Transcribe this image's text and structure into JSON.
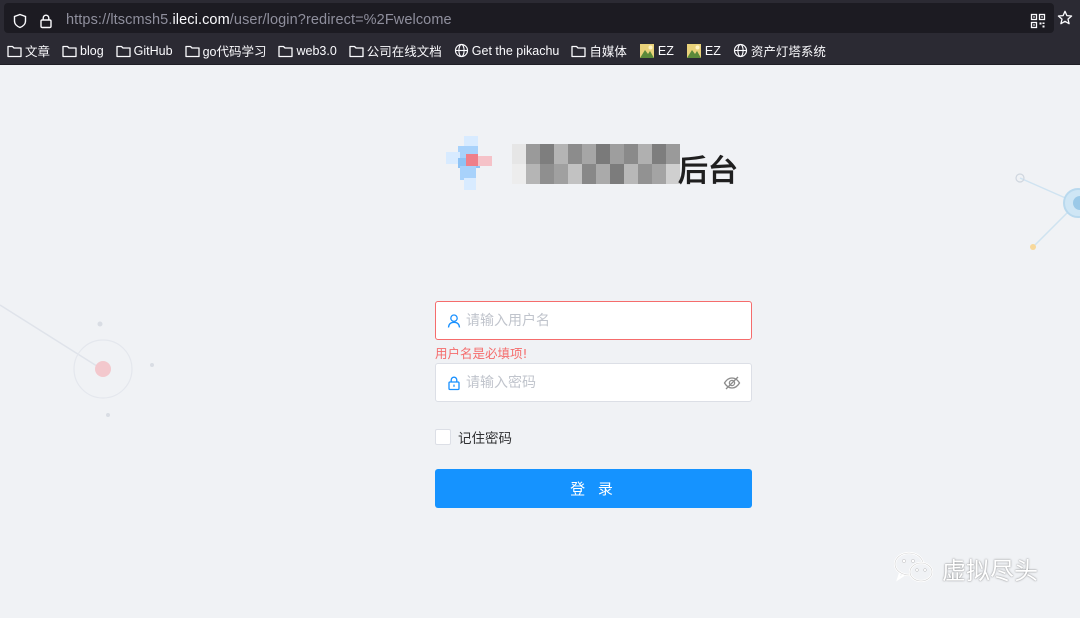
{
  "browser": {
    "url_scheme": "https://ltscmsh5.",
    "url_host": "ileci.com",
    "url_path": "/user/login?redirect=%2Fwelcome",
    "bookmarks": [
      {
        "label": "文章",
        "icon": "folder-icon"
      },
      {
        "label": "blog",
        "icon": "folder-icon"
      },
      {
        "label": "GitHub",
        "icon": "folder-icon"
      },
      {
        "label": "go代码学习",
        "icon": "folder-icon"
      },
      {
        "label": "web3.0",
        "icon": "folder-icon"
      },
      {
        "label": "公司在线文档",
        "icon": "folder-icon"
      },
      {
        "label": "Get the pikachu",
        "icon": "globe-icon"
      },
      {
        "label": "自媒体",
        "icon": "folder-icon"
      },
      {
        "label": "EZ",
        "icon": "image-favicon-icon"
      },
      {
        "label": "EZ",
        "icon": "image-favicon-icon"
      },
      {
        "label": "资产灯塔系统",
        "icon": "globe-icon"
      }
    ]
  },
  "header": {
    "title_suffix": "后台"
  },
  "form": {
    "username": {
      "value": "",
      "placeholder": "请输入用户名",
      "error": "用户名是必填项!"
    },
    "password": {
      "value": "",
      "placeholder": "请输入密码"
    },
    "remember_label": "记住密码",
    "remember_checked": false,
    "login_label": "登 录"
  },
  "watermark": {
    "text": "虚拟尽头"
  },
  "colors": {
    "primary": "#1593ff",
    "error": "#f56c6c",
    "page_bg": "#f0f2f5",
    "chrome_bg": "#2b2a33"
  }
}
